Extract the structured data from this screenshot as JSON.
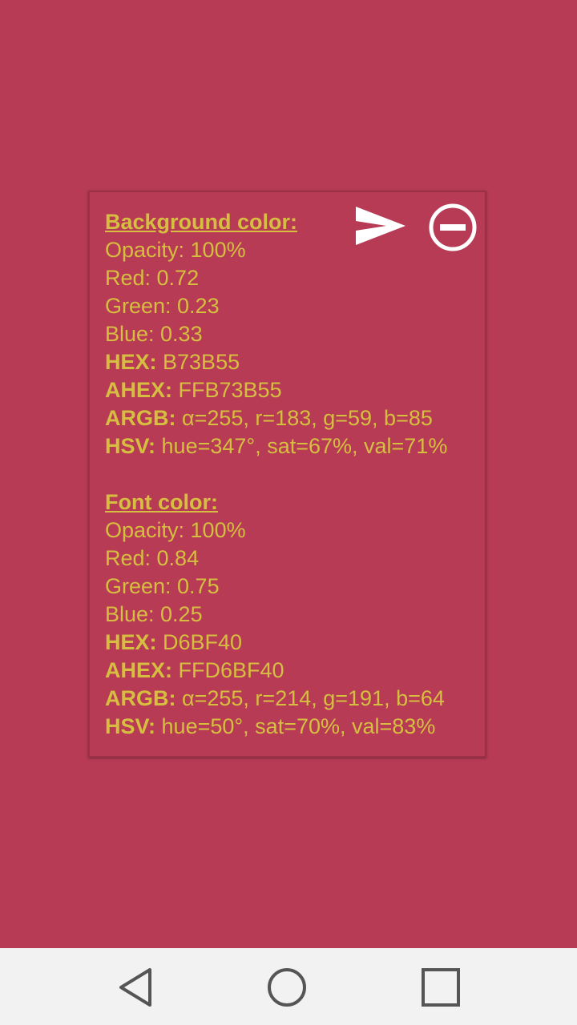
{
  "colors": {
    "background": "#B73B55",
    "font": "#D6BF40",
    "icon": "#FFFFFF",
    "navbar": "#F2F2F2",
    "nav_icon": "#555555"
  },
  "background_section": {
    "heading": "Background color:",
    "opacity": "Opacity: 100%",
    "red": "Red: 0.72",
    "green": "Green: 0.23",
    "blue": "Blue: 0.33",
    "hex_key": "HEX:",
    "hex_value": " B73B55",
    "ahex_key": "AHEX:",
    "ahex_value": " FFB73B55",
    "argb_key": "ARGB:",
    "argb_value": " α=255, r=183, g=59, b=85",
    "hsv_key": "HSV:",
    "hsv_value": " hue=347°, sat=67%, val=71%"
  },
  "font_section": {
    "heading": "Font color:",
    "opacity": "Opacity: 100%",
    "red": "Red: 0.84",
    "green": "Green: 0.75",
    "blue": "Blue: 0.25",
    "hex_key": "HEX:",
    "hex_value": " D6BF40",
    "ahex_key": "AHEX:",
    "ahex_value": " FFD6BF40",
    "argb_key": "ARGB:",
    "argb_value": " α=255, r=214, g=191, b=64",
    "hsv_key": "HSV:",
    "hsv_value": " hue=50°, sat=70%, val=83%"
  },
  "icons": {
    "share": "send-icon",
    "remove": "remove-circle-icon",
    "back": "back-triangle-icon",
    "home": "home-circle-icon",
    "recents": "recents-square-icon"
  }
}
